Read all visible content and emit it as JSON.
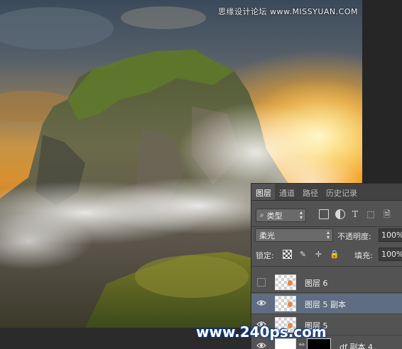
{
  "watermark": {
    "top": "思缘设计论坛 www.MISSYUAN.COM",
    "bottom": "www.240ps.com"
  },
  "layers_panel": {
    "tabs": [
      {
        "label": "图层",
        "active": true
      },
      {
        "label": "通道",
        "active": false
      },
      {
        "label": "路径",
        "active": false
      },
      {
        "label": "历史记录",
        "active": false
      }
    ],
    "filter": {
      "kind_label": "类型",
      "icons": [
        "image-filter-icon",
        "adjustment-filter-icon",
        "type-filter-icon",
        "shape-filter-icon",
        "smart-object-filter-icon"
      ]
    },
    "blend_mode": "柔光",
    "opacity_label": "不透明度:",
    "opacity_value": "100%",
    "lock_label": "锁定:",
    "fill_label": "填充:",
    "fill_value": "100%",
    "layers": [
      {
        "name": "图层 6",
        "visible": false,
        "selected": false
      },
      {
        "name": "图层 5 副本",
        "visible": true,
        "selected": true
      },
      {
        "name": "图层 5",
        "visible": true,
        "selected": false
      },
      {
        "name": "df 副本 4",
        "visible": true,
        "selected": false
      }
    ]
  },
  "colors": {
    "panel_bg": "#535353",
    "selected_layer": "#5e6d81",
    "watermark_outline": "#0d3b8a"
  }
}
